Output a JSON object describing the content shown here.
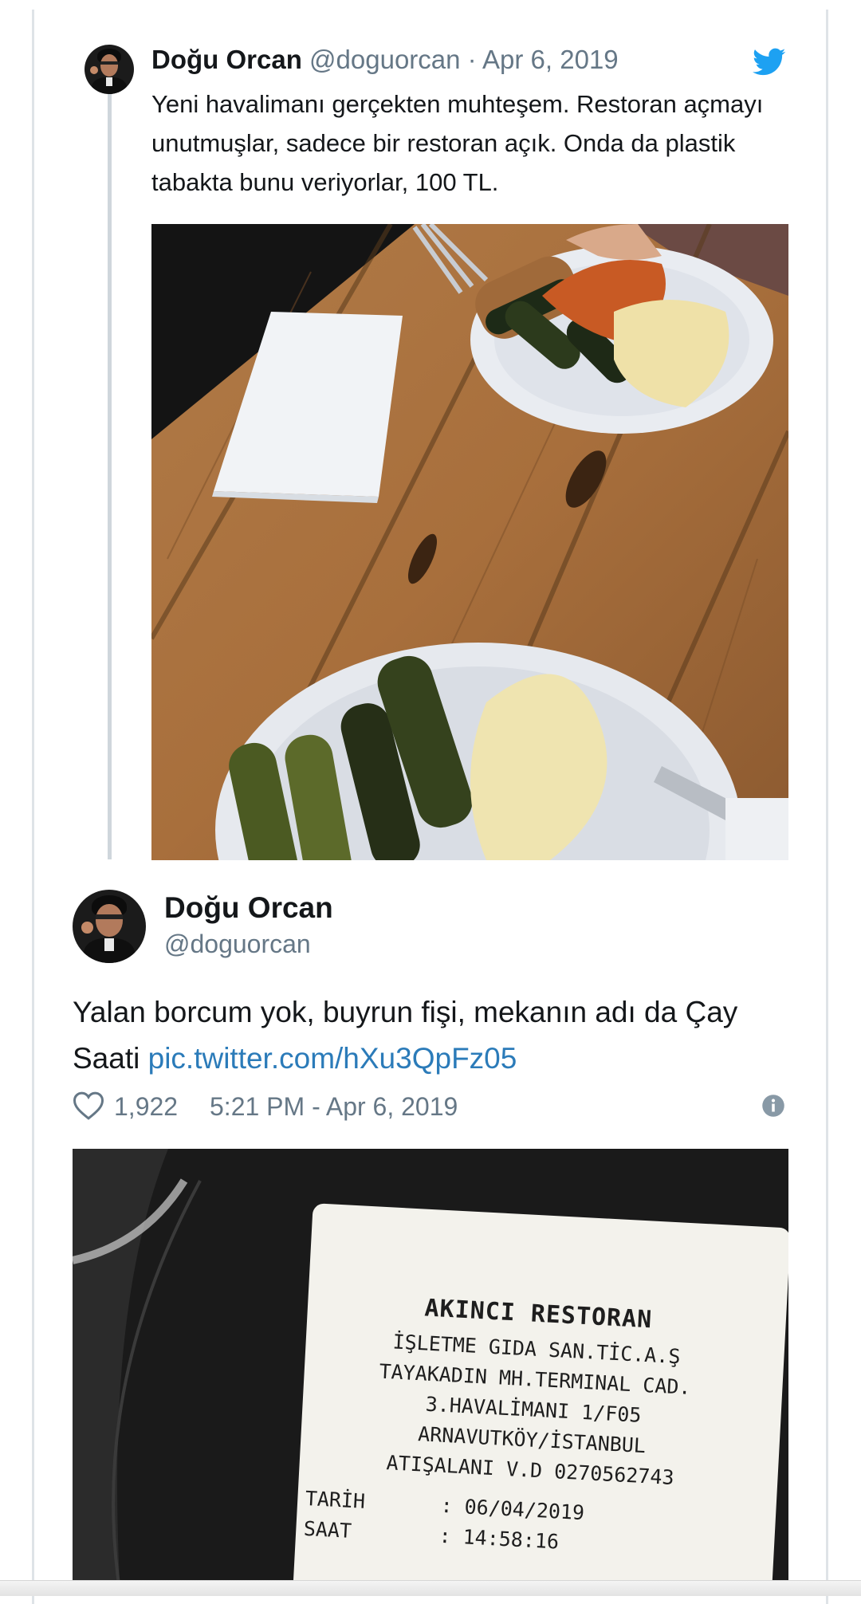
{
  "quoted_tweet": {
    "author_name": "Doğu Orcan",
    "handle": "@doguorcan",
    "separator": "·",
    "date": "Apr 6, 2019",
    "text": "Yeni havalimanı gerçekten muhteşem. Restoran açmayı unutmuşlar, sadece bir restoran açık. Onda da plastik tabakta bunu veriyorlar, 100 TL."
  },
  "tweet": {
    "author_name": "Doğu Orcan",
    "handle": "@doguorcan",
    "text": "Yalan borcum yok, buyrun fişi, mekanın adı da Çay Saati",
    "link": "pic.twitter.com/hXu3QpFz05",
    "likes": "1,922",
    "timestamp": "5:21 PM - Apr 6, 2019"
  },
  "receipt": {
    "lines": [
      "AKINCI RESTORAN",
      "İŞLETME GIDA SAN.TİC.A.Ş",
      "TAYAKADIN MH.TERMINAL CAD.",
      "3.HAVALİMANI 1/F05",
      "ARNAVUTKÖY/İSTANBUL",
      "ATIŞALANI V.D 0270562743"
    ],
    "date_label": "TARİH",
    "date_value": ": 06/04/2019",
    "time_label": "SAAT",
    "time_value": ": 14:58:16"
  },
  "icons": {
    "brand": "twitter-bird-icon",
    "like": "heart-icon",
    "info": "info-icon"
  },
  "colors": {
    "twitter_blue": "#1da1f2",
    "link_blue": "#2b7bb9",
    "muted_gray": "#657786"
  }
}
